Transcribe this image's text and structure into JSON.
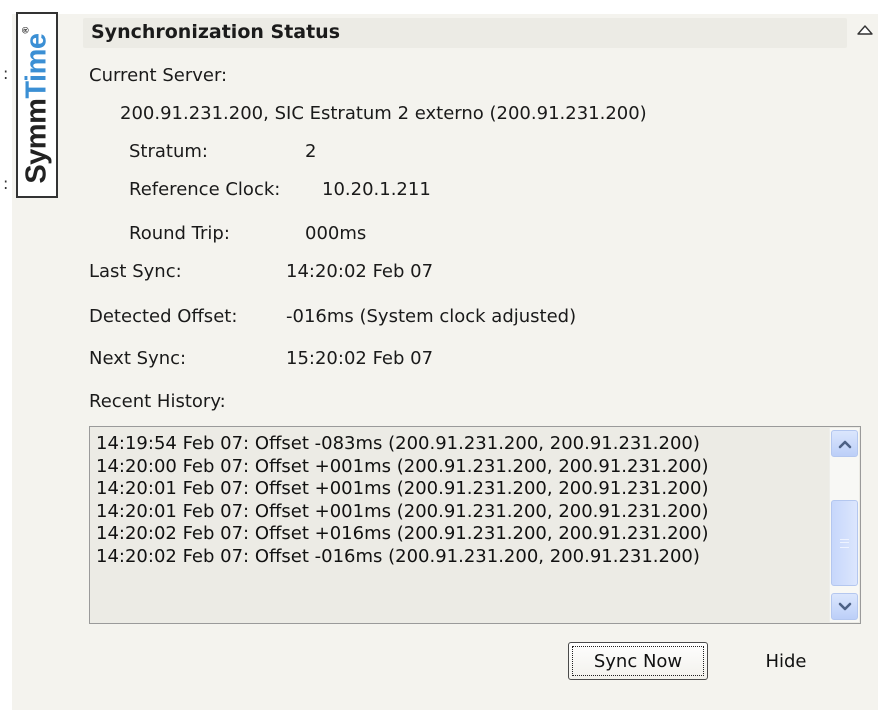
{
  "logo": {
    "symm": "Symm",
    "time": "Time",
    "tm": "®"
  },
  "title": "Synchronization Status",
  "labels": {
    "current_server": "Current Server:",
    "stratum": "Stratum:",
    "reference_clock": "Reference Clock:",
    "round_trip": "Round Trip:",
    "last_sync": "Last Sync:",
    "detected_offset": "Detected Offset:",
    "next_sync": "Next Sync:",
    "recent_history": "Recent History:"
  },
  "values": {
    "server": "200.91.231.200, SIC Estratum 2 externo (200.91.231.200)",
    "stratum": "2",
    "reference_clock": "10.20.1.211",
    "round_trip": "000ms",
    "last_sync": "14:20:02 Feb 07",
    "detected_offset": "-016ms (System clock adjusted)",
    "next_sync": "15:20:02 Feb 07"
  },
  "history": [
    "14:19:54 Feb 07: Offset -083ms  (200.91.231.200, 200.91.231.200)",
    "14:20:00 Feb 07: Offset +001ms  (200.91.231.200, 200.91.231.200)",
    "14:20:01 Feb 07: Offset +001ms  (200.91.231.200, 200.91.231.200)",
    "14:20:01 Feb 07: Offset +001ms  (200.91.231.200, 200.91.231.200)",
    "14:20:02 Feb 07: Offset +016ms  (200.91.231.200, 200.91.231.200)",
    "14:20:02 Feb 07: Offset -016ms  (200.91.231.200, 200.91.231.200)"
  ],
  "buttons": {
    "sync_now": "Sync Now",
    "hide": "Hide"
  },
  "icons": {
    "collapse": "chevron-up-icon",
    "scroll_up": "scroll-up-arrow-icon",
    "scroll_down": "scroll-down-arrow-icon",
    "grip": "scrollbar-grip-icon"
  },
  "colors": {
    "logo_time": "#3b8fd4",
    "panel_background": "#f4f3ee",
    "title_bar": "#ecebe5",
    "scrollbar_accent": "#c7d7fb"
  }
}
